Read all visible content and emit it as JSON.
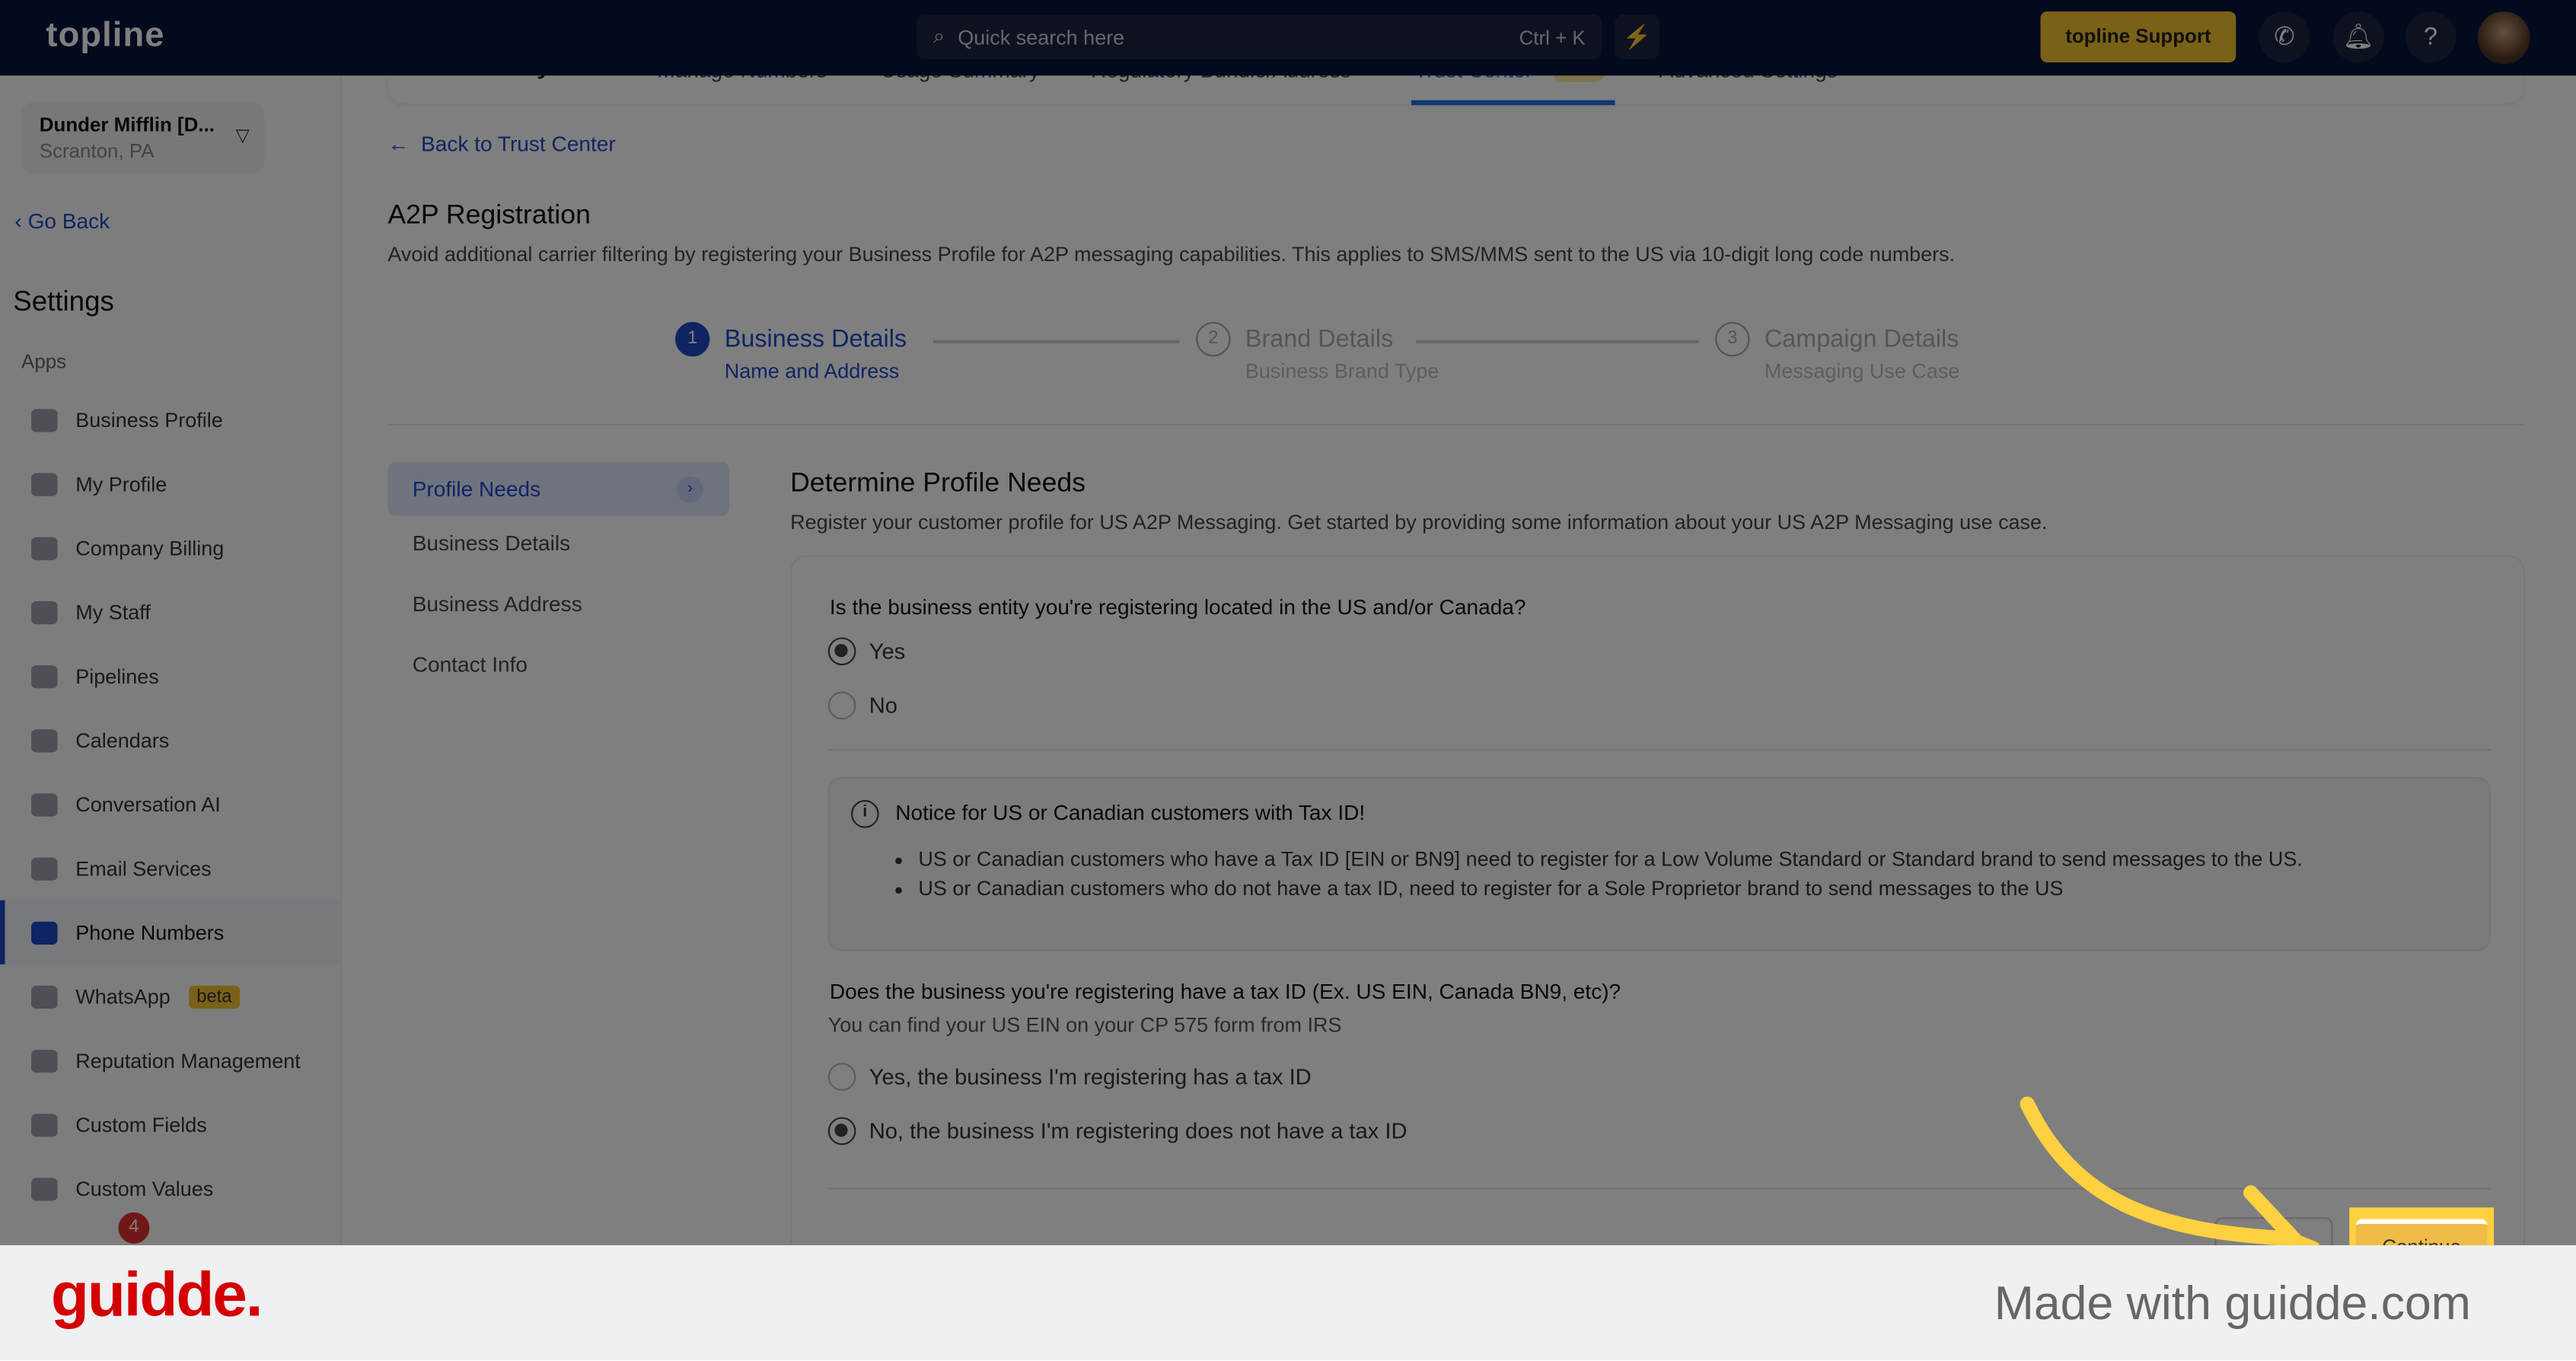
{
  "header": {
    "logo": "topline",
    "search_placeholder": "Quick search here",
    "search_shortcut": "Ctrl + K",
    "support_label": "topline Support"
  },
  "sidebar": {
    "location_name": "Dunder Mifflin [D...",
    "location_city": "Scranton, PA",
    "go_back": "Go Back",
    "title": "Settings",
    "section": "Apps",
    "items": [
      {
        "label": "Business Profile"
      },
      {
        "label": "My Profile"
      },
      {
        "label": "Company Billing"
      },
      {
        "label": "My Staff"
      },
      {
        "label": "Pipelines"
      },
      {
        "label": "Calendars"
      },
      {
        "label": "Conversation AI"
      },
      {
        "label": "Email Services"
      },
      {
        "label": "Phone Numbers",
        "active": true
      },
      {
        "label": "WhatsApp",
        "badge": "beta"
      },
      {
        "label": "Reputation Management"
      },
      {
        "label": "Custom Fields"
      },
      {
        "label": "Custom Values"
      }
    ],
    "notification_count": "4"
  },
  "tabs": {
    "title": "Phone System",
    "items": [
      "Manage Numbers",
      "Usage Summary",
      "Regulatory Bundle/Address",
      "Trust Center",
      "Advanced Settings"
    ],
    "new_badge": "New",
    "active": "Trust Center"
  },
  "main": {
    "back_link": "Back to Trust Center",
    "title": "A2P Registration",
    "subtitle": "Avoid additional carrier filtering by registering your Business Profile for A2P messaging capabilities. This applies to SMS/MMS sent to the US via 10-digit long code numbers.",
    "steps": [
      {
        "num": "1",
        "label": "Business Details",
        "sub": "Name and Address",
        "active": true
      },
      {
        "num": "2",
        "label": "Brand Details",
        "sub": "Business Brand Type"
      },
      {
        "num": "3",
        "label": "Campaign Details",
        "sub": "Messaging Use Case"
      }
    ],
    "subnav": [
      "Profile Needs",
      "Business Details",
      "Business Address",
      "Contact Info"
    ],
    "section_title": "Determine Profile Needs",
    "section_sub": "Register your customer profile for US A2P Messaging. Get started by providing some information about your US A2P Messaging use case.",
    "q1": "Is the business entity you're registering located in the US and/or Canada?",
    "q1_options": [
      "Yes",
      "No"
    ],
    "q1_selected": "Yes",
    "notice_title": "Notice for US or Canadian customers with Tax ID!",
    "notice_items": [
      "US or Canadian customers who have a Tax ID [EIN or BN9] need to register for a Low Volume Standard or Standard brand to send messages to the US.",
      "US or Canadian customers who do not have a tax ID, need to register for a Sole Proprietor brand to send messages to the US"
    ],
    "q2": "Does the business you're registering have a tax ID (Ex. US EIN, Canada BN9, etc)?",
    "q2_hint": "You can find your US EIN on your CP 575 form from IRS",
    "q2_options": [
      "Yes, the business I'm registering has a tax ID",
      "No, the business I'm registering does not have a tax ID"
    ],
    "q2_selected": "No, the business I'm registering does not have a tax ID",
    "continue_label": "Continue"
  },
  "footer": {
    "brand": "guidde.",
    "made_with": "Made with guidde.com"
  },
  "colors": {
    "accent": "#1f49c6",
    "highlight": "#ffd040",
    "header": "#04143a",
    "brand": "#d40000"
  }
}
